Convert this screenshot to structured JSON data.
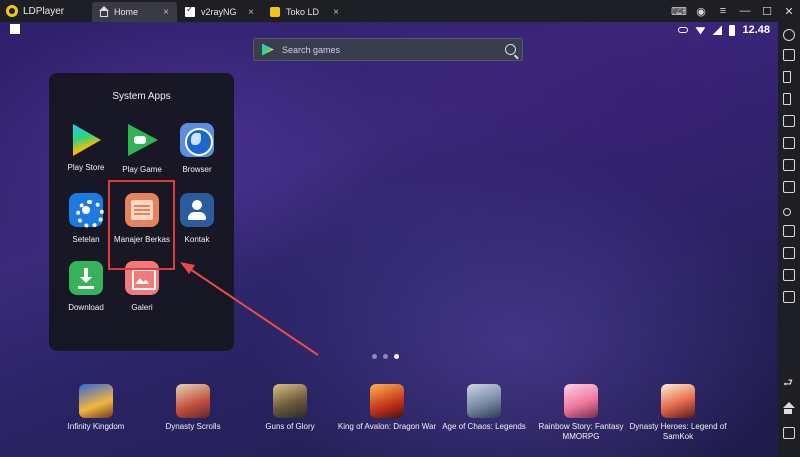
{
  "titlebar": {
    "app_name": "LDPlayer",
    "tabs": [
      {
        "label": "Home",
        "icon": "home-icon",
        "active": true
      },
      {
        "label": "v2rayNG",
        "icon": "v2rayng-icon",
        "active": false
      },
      {
        "label": "Toko LD",
        "icon": "toko-ld-icon",
        "active": false
      }
    ],
    "tab_close": "×",
    "controls": [
      "gamepad-icon",
      "account-icon",
      "menu-icon",
      "minimize-icon",
      "maximize-icon",
      "close-icon"
    ]
  },
  "status_bar": {
    "time": "12.48"
  },
  "search": {
    "placeholder": "Search games"
  },
  "folder": {
    "title": "System Apps",
    "apps": [
      {
        "label": "Play Store"
      },
      {
        "label": "Play Game"
      },
      {
        "label": "Browser"
      },
      {
        "label": "Setelan"
      },
      {
        "label": "Manajer Berkas"
      },
      {
        "label": "Kontak"
      },
      {
        "label": "Download"
      },
      {
        "label": "Galeri"
      }
    ],
    "highlight_color": "#e23b3b"
  },
  "pager": {
    "active_page": 3,
    "total_pages": 3
  },
  "dock": {
    "games": [
      {
        "label": "Infinity Kingdom"
      },
      {
        "label": "Dynasty Scrolls"
      },
      {
        "label": "Guns of Glory"
      },
      {
        "label": "King of Avalon: Dragon War"
      },
      {
        "label": "Age of Chaos: Legends"
      },
      {
        "label": "Rainbow Story: Fantasy MMORPG"
      },
      {
        "label": "Dynasty Heroes: Legend of SamKok"
      }
    ]
  },
  "colors": {
    "accent_arrow": "#e84a4a",
    "titlebar_bg": "#1e1f24"
  }
}
